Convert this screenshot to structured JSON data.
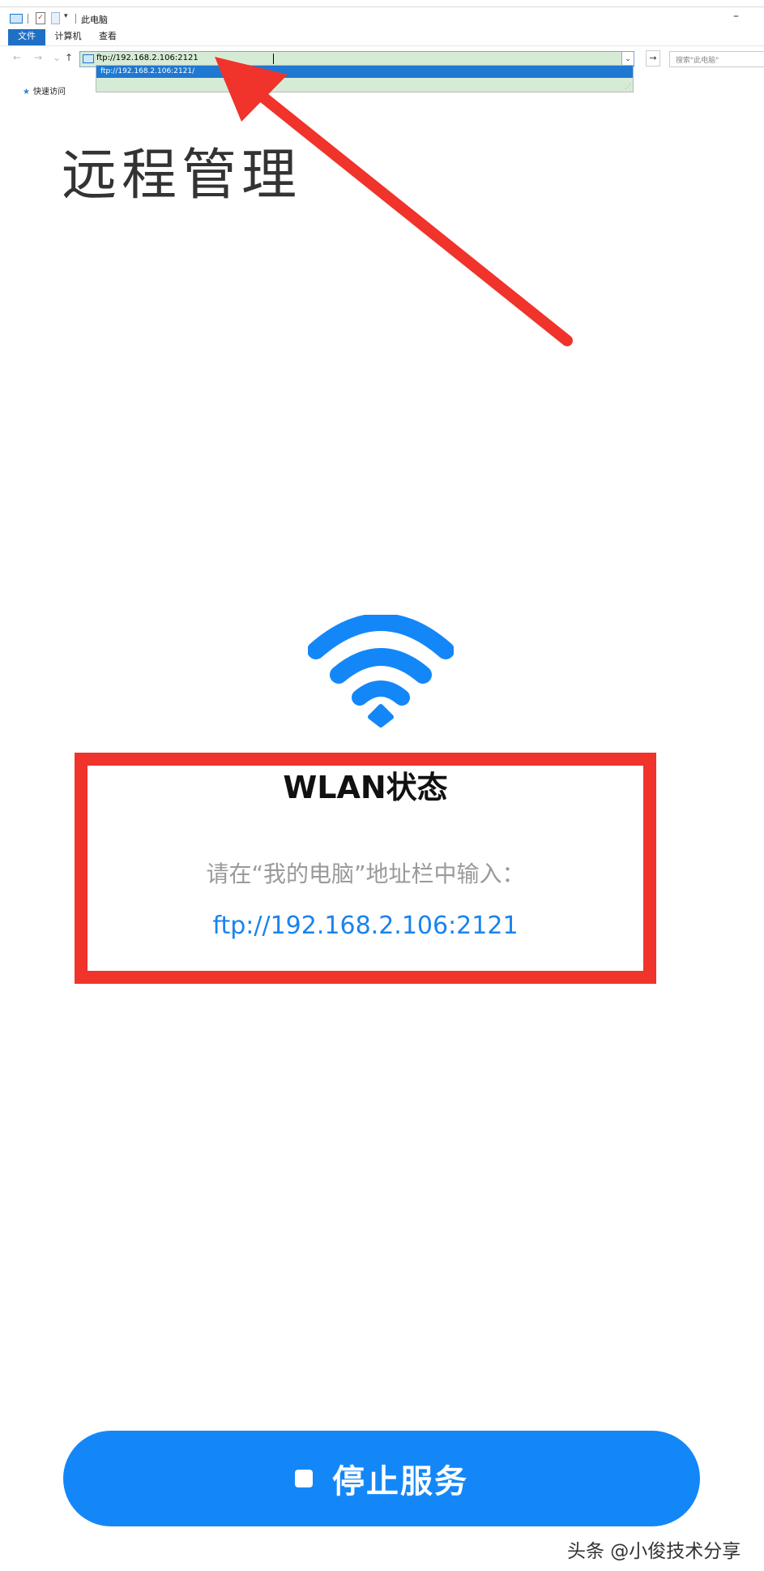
{
  "explorer": {
    "window_title": "此电脑",
    "minimize_glyph": "–",
    "ribbon_tabs": [
      "文件",
      "计算机",
      "查看"
    ],
    "address_value": "ftp://192.168.2.106:2121",
    "autocomplete_suggestion": "ftp://192.168.2.106:2121/",
    "search_placeholder": "搜索\"此电脑\"",
    "sidebar_quick_access": "快速访问",
    "nav": {
      "back": "←",
      "forward": "→",
      "recent": "⌄",
      "up": "↑",
      "go": "→",
      "dropdown": "⌄"
    }
  },
  "app": {
    "title": "远程管理",
    "status_title": "WLAN状态",
    "instruction": "请在“我的电脑”地址栏中输入：",
    "ftp_url": "ftp://192.168.2.106:2121",
    "stop_button_label": "停止服务"
  },
  "watermark": "头条 @小俊技术分享",
  "colors": {
    "accent_blue": "#1487f8",
    "link_blue": "#1a83ee",
    "annotation_red": "#f0332b",
    "explorer_file_tab": "#1f6fc4"
  },
  "icons": {
    "wifi": "wifi-icon",
    "stop": "stop-square-icon",
    "quick_access": "star-icon",
    "computer": "computer-icon"
  }
}
